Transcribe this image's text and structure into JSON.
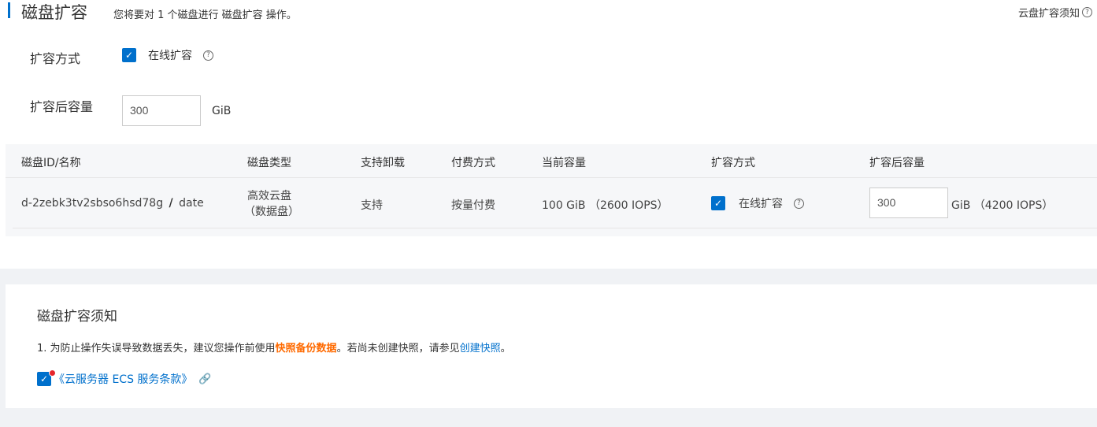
{
  "header": {
    "title": "磁盘扩容",
    "subtitle": "您将要对 1 个磁盘进行 磁盘扩容 操作。",
    "notice_link": "云盘扩容须知",
    "help_glyph": "?"
  },
  "form": {
    "method_label": "扩容方式",
    "method_option": "在线扩容",
    "method_checked": true,
    "capacity_label": "扩容后容量",
    "capacity_value": "300",
    "capacity_unit": "GiB"
  },
  "table": {
    "headers": [
      "磁盘ID/名称",
      "磁盘类型",
      "支持卸载",
      "付费方式",
      "当前容量",
      "扩容方式",
      "扩容后容量"
    ],
    "row": {
      "disk_id": "d-2zebk3tv2sbso6hsd78g",
      "separator": "/",
      "disk_name": "date",
      "type_line1": "高效云盘",
      "type_line2": "（数据盘）",
      "detachable": "支持",
      "billing": "按量付费",
      "current_capacity": "100 GiB （2600 IOPS）",
      "method_option": "在线扩容",
      "method_checked": true,
      "new_capacity_value": "300",
      "new_capacity_suffix": "GiB （4200 IOPS）"
    }
  },
  "notice": {
    "title": "磁盘扩容须知",
    "item1_prefix": "1. 为防止操作失误导致数据丢失，建议您操作前使用",
    "item1_highlight": "快照备份数据",
    "item1_middle": "。若尚未创建快照，请参见",
    "item1_link": "创建快照",
    "item1_suffix": "。",
    "terms_label": "《云服务器 ECS 服务条款》",
    "terms_checked": true
  },
  "icons": {
    "check": "✓",
    "link": "🔗"
  },
  "colors": {
    "accent": "#0070cc",
    "highlight": "#ff6a00",
    "badge": "#e6262c"
  }
}
